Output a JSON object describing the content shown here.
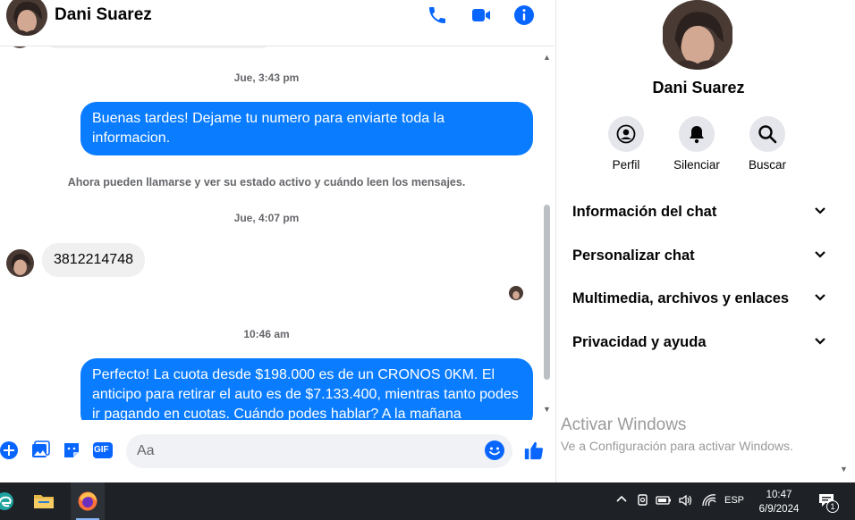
{
  "contact": {
    "name": "Dani Suarez"
  },
  "messages": {
    "timestamps": [
      "Jue, 3:43 pm",
      "Jue, 4:07 pm",
      "10:46 am"
    ],
    "system_notice": "Ahora pueden llamarse y ver su estado activo y cuándo leen los mensajes.",
    "out_1": "Buenas tardes! Dejame tu numero para enviarte toda la informacion.",
    "in_1": "3812214748",
    "out_2": "Perfecto! La cuota desde $198.000 es de un CRONOS 0KM. El anticipo para retirar el auto es de $7.133.400, mientras tanto podes ir pagando en cuotas. Cuándo podes hablar? A la mañana"
  },
  "composer": {
    "placeholder": "Aa",
    "gif_label": "GIF"
  },
  "side_panel": {
    "name": "Dani Suarez",
    "actions": [
      {
        "label": "Perfil",
        "icon": "profile-icon"
      },
      {
        "label": "Silenciar",
        "icon": "bell-icon"
      },
      {
        "label": "Buscar",
        "icon": "search-icon"
      }
    ],
    "sections": [
      "Información del chat",
      "Personalizar chat",
      "Multimedia, archivos y enlaces",
      "Privacidad y ayuda"
    ],
    "watermark_title": "Activar Windows",
    "watermark_sub": "Ve a Configuración para activar Windows."
  },
  "taskbar": {
    "language": "ESP",
    "time": "10:47",
    "date": "6/9/2024",
    "notification_count": "1"
  },
  "colors": {
    "accent": "#0a7cff",
    "icon_blue": "#0866ff",
    "bubble_in": "#f0f0f0",
    "taskbar": "#1e2227"
  }
}
